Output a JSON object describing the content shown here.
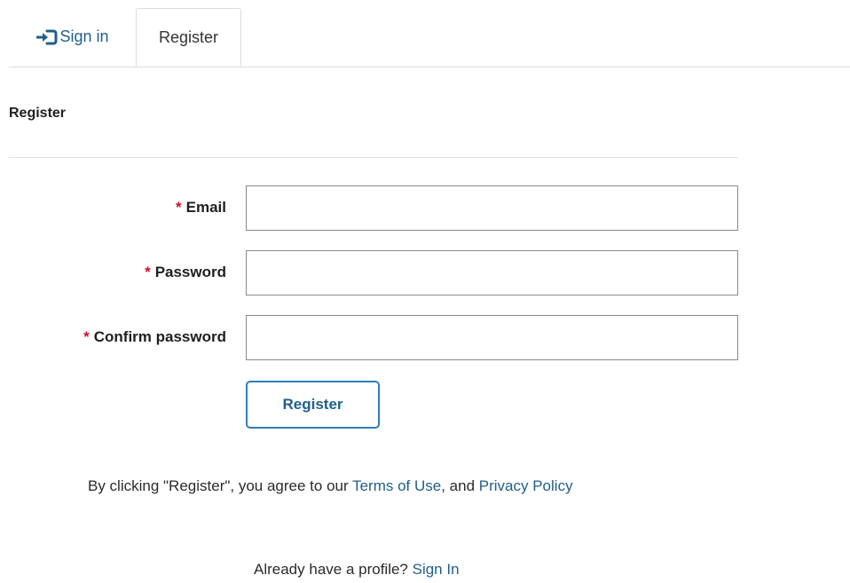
{
  "tabs": {
    "signin_label": "Sign in",
    "signin_icon": "sign-in-icon",
    "register_label": "Register"
  },
  "section": {
    "title": "Register"
  },
  "form": {
    "required_marker": "*",
    "email": {
      "label": "Email",
      "value": ""
    },
    "password": {
      "label": "Password",
      "value": ""
    },
    "confirm_password": {
      "label": "Confirm password",
      "value": ""
    },
    "submit_label": "Register"
  },
  "agreement": {
    "prefix": "By clicking \"Register\", you agree to our ",
    "terms_link": "Terms of Use",
    "middle": ", and ",
    "privacy_link": "Privacy Policy"
  },
  "footer": {
    "prompt": "Already have a profile? ",
    "signin_link": "Sign In"
  },
  "colors": {
    "link": "#1f5f8b",
    "required": "#c8102e",
    "button_border": "#2e7dbb"
  }
}
